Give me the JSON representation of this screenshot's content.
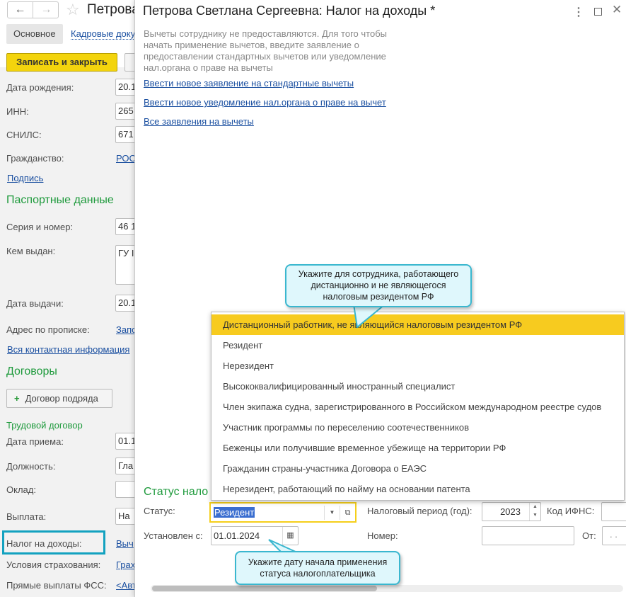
{
  "back_form": {
    "title": "Петрова",
    "tabs": [
      "Основное",
      "Кадровые доку"
    ],
    "save_close": "Записать и закрыть",
    "fields": [
      {
        "label": "Дата рождения:",
        "value": "20.1"
      },
      {
        "label": "ИНН:",
        "value": "265"
      },
      {
        "label": "СНИЛС:",
        "value": "671"
      },
      {
        "label": "Гражданство:",
        "value": "РОС"
      }
    ],
    "signature_link": "Подпись",
    "passport_header": "Паспортные данные",
    "passport": [
      {
        "label": "Серия и номер:",
        "value": "46 1"
      },
      {
        "label": "Кем выдан:",
        "value": "ГУ I"
      },
      {
        "label": "Дата выдачи:",
        "value": "20.1"
      },
      {
        "label": "Адрес по прописке:",
        "value": "Запо"
      }
    ],
    "contact_link": "Вся контактная информация",
    "contracts_header": "Договоры",
    "contract_button": "Договор подряда",
    "labor_header": "Трудовой договор",
    "labor": [
      {
        "label": "Дата приема:",
        "value": "01.1"
      },
      {
        "label": "Должность:",
        "value": "Гла"
      },
      {
        "label": "Оклад:",
        "value": ""
      },
      {
        "label": "Выплата:",
        "value": "На"
      },
      {
        "label": "Налог на доходы:",
        "value": "Выч"
      },
      {
        "label": "Условия страхования:",
        "value": "Грах"
      },
      {
        "label": "Прямые выплаты ФСС:",
        "value": "<Авт"
      }
    ]
  },
  "dialog": {
    "title": "Петрова Светлана Сергеевна: Налог на доходы *",
    "info_lines": [
      "Вычеты сотруднику не предоставляются. Для того чтобы",
      "начать применение вычетов, введите заявление о",
      "предоставлении стандартных вычетов или уведомление",
      "нал.органа о праве на вычеты"
    ],
    "links": [
      "Ввести новое заявление на стандартные вычеты",
      "Ввести новое уведомление нал.органа о праве на вычет",
      "Все заявления на вычеты"
    ],
    "status_section": "Статус нало",
    "status_label": "Статус:",
    "status_value": "Резидент",
    "period_label": "Налоговый период (год):",
    "period_value": "2023",
    "ifns_label": "Код ИФНС:",
    "since_label": "Установлен с:",
    "since_value": "01.01.2024",
    "number_label": "Номер:",
    "from_label": "От:",
    "from_value": ". .",
    "dropdown": [
      "Дистанционный работник, не являющийся налоговым резидентом РФ",
      "Резидент",
      "Нерезидент",
      "Высококвалифицированный иностранный специалист",
      "Член экипажа судна, зарегистрированного в Российском международном реестре судов",
      "Участник программы по переселению соотечественников",
      "Беженцы или получившие временное убежище на территории РФ",
      "Гражданин страны-участника Договора о ЕАЭС",
      "Нерезидент, работающий по найму на основании патента"
    ]
  },
  "tooltips": {
    "top": [
      "Укажите для сотрудника, работающего",
      "дистанционно и не являющегося",
      "налоговым резидентом РФ"
    ],
    "bottom": [
      "Укажите дату начала применения",
      "статуса налогоплательщика"
    ]
  },
  "colors": {
    "accent_yellow": "#f5cf1b",
    "highlight_box": "#13a2c0",
    "section_green": "#1e9a3c",
    "link": "#1a4fa0"
  }
}
